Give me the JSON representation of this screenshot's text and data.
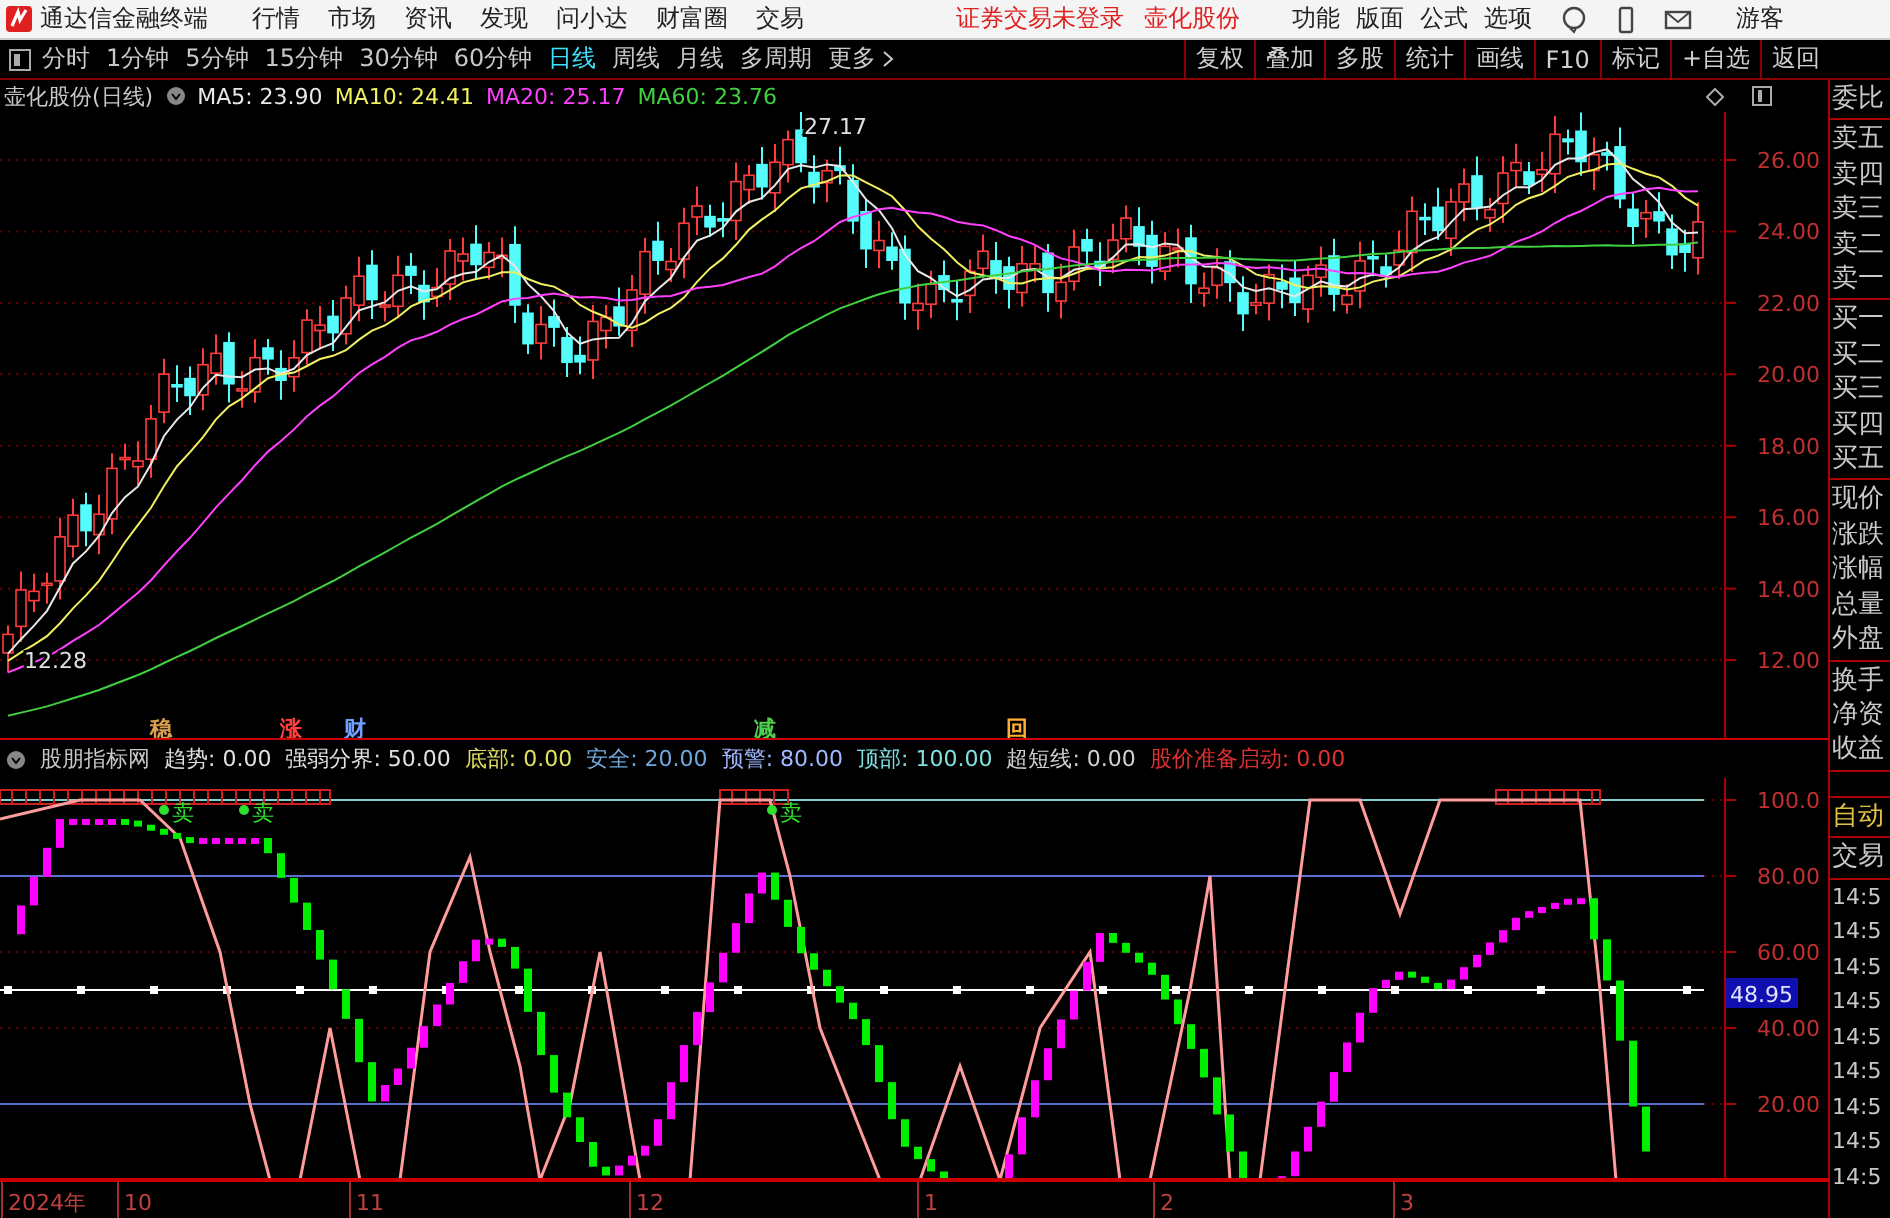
{
  "app": {
    "title": "通达信金融终端",
    "menu": [
      "行情",
      "市场",
      "资讯",
      "发现",
      "问小达",
      "财富圈",
      "交易"
    ],
    "notice": "证券交易未登录",
    "stock": "壶化股份",
    "tools": [
      "功能",
      "版面",
      "公式",
      "选项"
    ],
    "user": "游客"
  },
  "toolbar": {
    "periods": [
      {
        "label": "分时",
        "selected": false
      },
      {
        "label": "1分钟",
        "selected": false
      },
      {
        "label": "5分钟",
        "selected": false
      },
      {
        "label": "15分钟",
        "selected": false
      },
      {
        "label": "30分钟",
        "selected": false
      },
      {
        "label": "60分钟",
        "selected": false
      },
      {
        "label": "日线",
        "selected": true
      },
      {
        "label": "周线",
        "selected": false
      },
      {
        "label": "月线",
        "selected": false
      },
      {
        "label": "多周期",
        "selected": false
      }
    ],
    "more": "更多",
    "actions": [
      "复权",
      "叠加",
      "多股",
      "统计",
      "画线",
      "F10",
      "标记",
      "+自选",
      "返回"
    ]
  },
  "chart": {
    "title": "壶化股份(日线)",
    "ma": [
      {
        "label": "MA5: 23.90",
        "color": "#e8e8e8"
      },
      {
        "label": "MA10: 24.41",
        "color": "#f0f060"
      },
      {
        "label": "MA20: 25.17",
        "color": "#ff40ff"
      },
      {
        "label": "MA60: 23.76",
        "color": "#40d040"
      }
    ],
    "high": "27.17",
    "low": "12.28",
    "price_axis": [
      "26.00",
      "24.00",
      "22.00",
      "20.00",
      "18.00",
      "16.00",
      "14.00",
      "12.00"
    ],
    "markers": [
      {
        "text": "稳",
        "color": "#d8a050"
      },
      {
        "text": "涨",
        "color": "#ff4040"
      },
      {
        "text": "财",
        "color": "#6fa0ff"
      },
      {
        "text": "减",
        "color": "#50d050"
      },
      {
        "text": "回",
        "color": "#ffb030"
      }
    ]
  },
  "indicator": {
    "name": "股朋指标网",
    "values": [
      {
        "text": "趋势: 0.00",
        "color": "#e0e0e0"
      },
      {
        "text": "强弱分界: 50.00",
        "color": "#e0e0e0"
      },
      {
        "text": "底部: 0.00",
        "color": "#e0e060"
      },
      {
        "text": "安全: 20.00",
        "color": "#6fa8dc"
      },
      {
        "text": "预警: 80.00",
        "color": "#9fb8ff"
      },
      {
        "text": "顶部: 100.00",
        "color": "#80e0e0"
      },
      {
        "text": "超短线: 0.00",
        "color": "#d0d0d0"
      },
      {
        "text": "股价准备启动: 0.00",
        "color": "#e03030"
      }
    ],
    "signals": [
      "卖",
      "卖",
      "卖"
    ],
    "axis": [
      "100.0",
      "80.00",
      "60.00",
      "40.00",
      "20.00"
    ],
    "current": "48.95"
  },
  "dates": [
    "2024年",
    "10",
    "11",
    "12",
    "1",
    "2",
    "3"
  ],
  "side": {
    "sections": [
      [
        "委比"
      ],
      [
        "卖五",
        "卖四",
        "卖三",
        "卖二",
        "卖一"
      ],
      [
        "买一",
        "买二",
        "买三",
        "买四",
        "买五"
      ],
      [
        "现价",
        "涨跌",
        "涨幅",
        "总量",
        "外盘"
      ],
      [
        "换手",
        "净资",
        "收益"
      ]
    ],
    "auto": "自动",
    "trade": "交易",
    "times": [
      "14:5",
      "14:5",
      "14:5",
      "14:5",
      "14:5",
      "14:5",
      "14:5",
      "14:5",
      "14:5"
    ]
  }
}
